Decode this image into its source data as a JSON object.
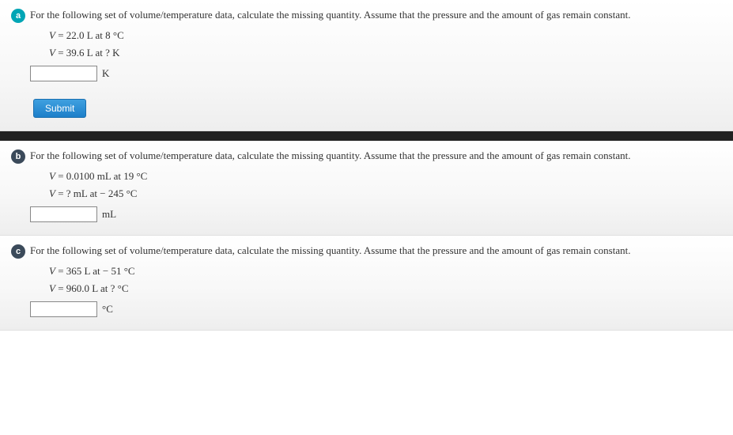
{
  "parts": {
    "a": {
      "label": "a",
      "prompt": "For the following set of volume/temperature data, calculate the missing quantity. Assume that the pressure and the amount of gas remain constant.",
      "line1_pre": "V",
      "line1_rest": " = 22.0 L at 8 °C",
      "line2_pre": "V",
      "line2_rest": " = 39.6 L at ? K",
      "unit": "K",
      "submit": "Submit"
    },
    "b": {
      "label": "b",
      "prompt": "For the following set of volume/temperature data, calculate the missing quantity. Assume that the pressure and the amount of gas remain constant.",
      "line1_pre": "V",
      "line1_rest": " = 0.0100 mL at 19 °C",
      "line2_pre": "V",
      "line2_rest": " =  ? mL at  − 245 °C",
      "unit": "mL"
    },
    "c": {
      "label": "c",
      "prompt": "For the following set of volume/temperature data, calculate the missing quantity. Assume that the pressure and the amount of gas remain constant.",
      "line1_pre": "V",
      "line1_rest": " = 365 L at − 51 °C",
      "line2_pre": "V",
      "line2_rest": " = 960.0 L at ? °C",
      "unit": "°C"
    }
  }
}
